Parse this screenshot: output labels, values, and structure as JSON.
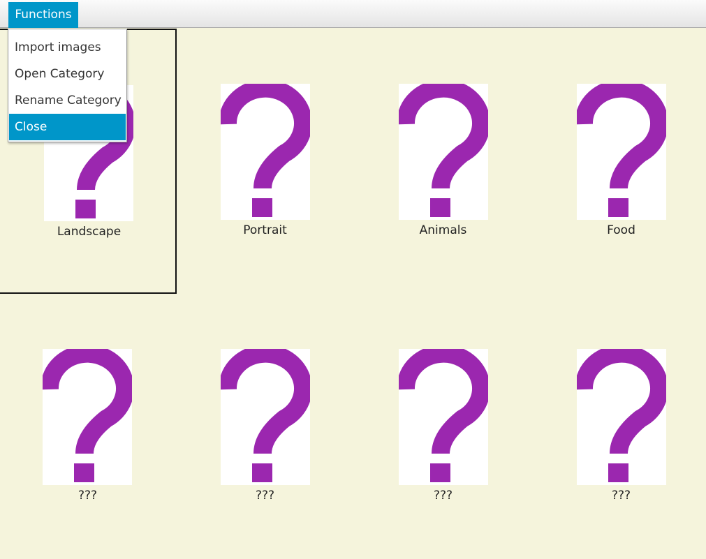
{
  "menubar": {
    "functions_label": "Functions"
  },
  "menu": {
    "items": [
      {
        "label": "Import images"
      },
      {
        "label": "Open Category"
      },
      {
        "label": "Rename Category"
      },
      {
        "label": "Close"
      }
    ],
    "highlighted": "Close"
  },
  "grid": {
    "tiles": [
      {
        "label": "Landscape",
        "icon": "question-mark-icon",
        "selected": true
      },
      {
        "label": "Portrait",
        "icon": "question-mark-icon",
        "selected": false
      },
      {
        "label": "Animals",
        "icon": "question-mark-icon",
        "selected": false
      },
      {
        "label": "Food",
        "icon": "question-mark-icon",
        "selected": false
      },
      {
        "label": "???",
        "icon": "question-mark-icon",
        "selected": false
      },
      {
        "label": "???",
        "icon": "question-mark-icon",
        "selected": false
      },
      {
        "label": "???",
        "icon": "question-mark-icon",
        "selected": false
      },
      {
        "label": "???",
        "icon": "question-mark-icon",
        "selected": false
      }
    ]
  },
  "colors": {
    "background": "#f5f4dc",
    "accent": "#0096c9",
    "icon": "#9b27af",
    "selection_border": "#111111"
  }
}
